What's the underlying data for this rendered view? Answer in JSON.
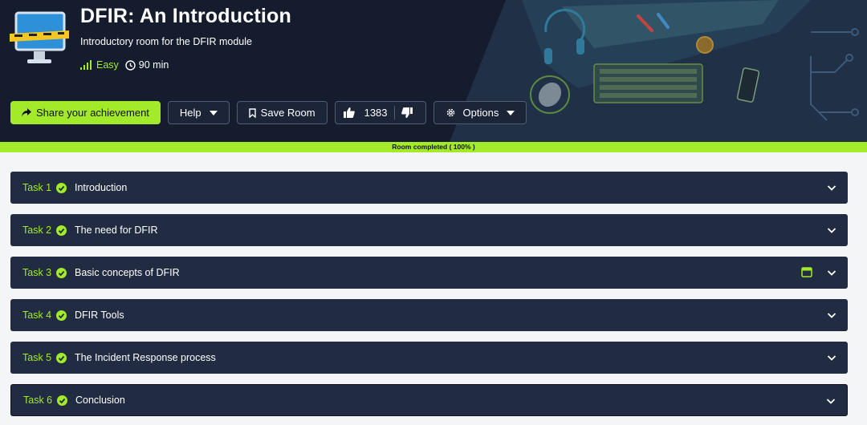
{
  "room": {
    "title": "DFIR: An Introduction",
    "subtitle": "Introductory room for the DFIR module",
    "difficulty": "Easy",
    "duration": "90 min"
  },
  "actions": {
    "share_label": "Share your achievement",
    "help_label": "Help",
    "save_label": "Save Room",
    "likes": "1383",
    "options_label": "Options"
  },
  "progress": {
    "label": "Room completed ( 100% )",
    "percent": 100
  },
  "colors": {
    "accent": "#a3ea2a",
    "header_bg": "#141c2d",
    "task_bg": "#212c42"
  },
  "tasks": [
    {
      "number": "Task 1",
      "title": "Introduction",
      "completed": true,
      "has_machine": false
    },
    {
      "number": "Task 2",
      "title": "The need for DFIR",
      "completed": true,
      "has_machine": false
    },
    {
      "number": "Task 3",
      "title": "Basic concepts of DFIR",
      "completed": true,
      "has_machine": true
    },
    {
      "number": "Task 4",
      "title": "DFIR Tools",
      "completed": true,
      "has_machine": false
    },
    {
      "number": "Task 5",
      "title": "The Incident Response process",
      "completed": true,
      "has_machine": false
    },
    {
      "number": "Task 6",
      "title": "Conclusion",
      "completed": true,
      "has_machine": false
    }
  ]
}
